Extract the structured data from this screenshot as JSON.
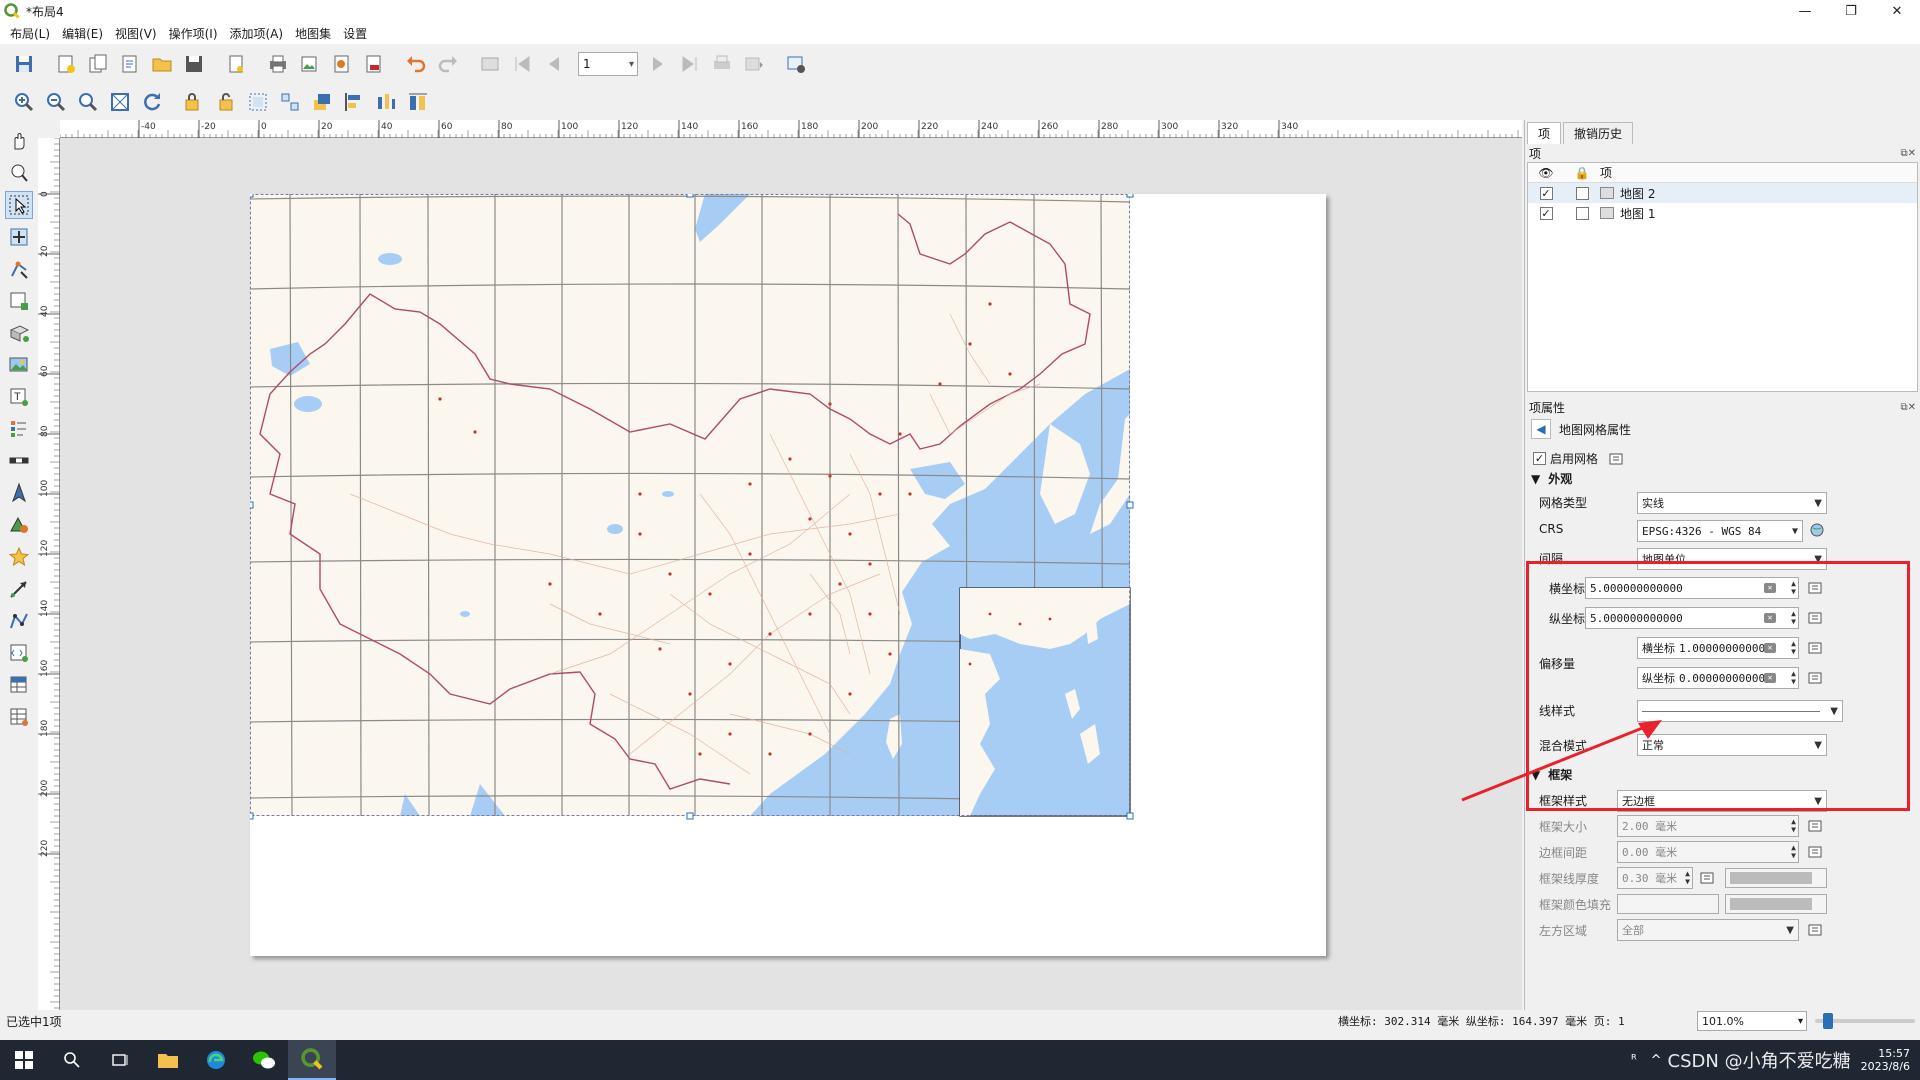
{
  "window": {
    "title": "*布局4",
    "minimize": "—",
    "maximize": "❐",
    "close": "✕"
  },
  "menu": [
    "布局(L)",
    "编辑(E)",
    "视图(V)",
    "操作项(I)",
    "添加项(A)",
    "地图集",
    "设置"
  ],
  "toolbar": {
    "page_value": "1"
  },
  "rulers": {
    "h_ticks": [
      "-40",
      "-20",
      "0",
      "20",
      "40",
      "60",
      "80",
      "100",
      "120",
      "140",
      "160",
      "180",
      "200",
      "220",
      "240",
      "260",
      "280",
      "300",
      "320",
      "340"
    ],
    "v_ticks": [
      "0",
      "20",
      "40",
      "60",
      "80",
      "100",
      "120",
      "140",
      "160",
      "180",
      "200",
      "220"
    ]
  },
  "right_panel": {
    "tabs": [
      "项",
      "撤销历史"
    ],
    "items_title": "项",
    "items_header": "项",
    "items": [
      {
        "label": "地图 2",
        "visible": true,
        "locked": false
      },
      {
        "label": "地图 1",
        "visible": true,
        "locked": false
      }
    ],
    "props_title": "项属性",
    "props_subtitle": "地图网格属性",
    "enable_grid": "启用网格",
    "section_appearance": "外观",
    "grid_type_label": "网格类型",
    "grid_type_value": "实线",
    "crs_label": "CRS",
    "crs_value": "EPSG:4326 - WGS 84",
    "interval_label": "间隔",
    "interval_value": "地图单位",
    "x_label": "横坐标",
    "x_value": "5.000000000000",
    "y_label": "纵坐标",
    "y_value": "5.000000000000",
    "offset_label": "偏移量",
    "offset_x_prefix": "横坐标",
    "offset_x_value": "1.000000000000",
    "offset_y_prefix": "纵坐标",
    "offset_y_value": "0.000000000000",
    "line_style_label": "线样式",
    "blend_label": "混合模式",
    "blend_value": "正常",
    "section_frame": "框架",
    "frame_style_label": "框架样式",
    "frame_style_value": "无边框",
    "frame_size_label": "框架大小",
    "frame_size_value": "2.00 毫米",
    "frame_margin_label": "边框间距",
    "frame_margin_value": "0.00 毫米",
    "frame_line_label": "框架线厚度",
    "frame_line_value": "0.30 毫米",
    "frame_fill_label": "框架颜色填充",
    "left_side_label": "左方区域",
    "left_side_value": "全部"
  },
  "status": {
    "selection": "已选中1项",
    "coords": "横坐标: 302.314 毫米 纵坐标: 164.397 毫米 页: 1",
    "zoom": "101.0%"
  },
  "taskbar": {
    "time": "15:57",
    "date": "2023/8/6",
    "watermark": "CSDN @小角不爱吃糖"
  },
  "colors": {
    "accent": "#2a6fb5",
    "highlight_red": "#e8212b",
    "map_land": "#fbf7ef",
    "map_water": "#a7cdf5",
    "grid_line": "#8a8a8a",
    "border_line": "#b04a6a"
  }
}
